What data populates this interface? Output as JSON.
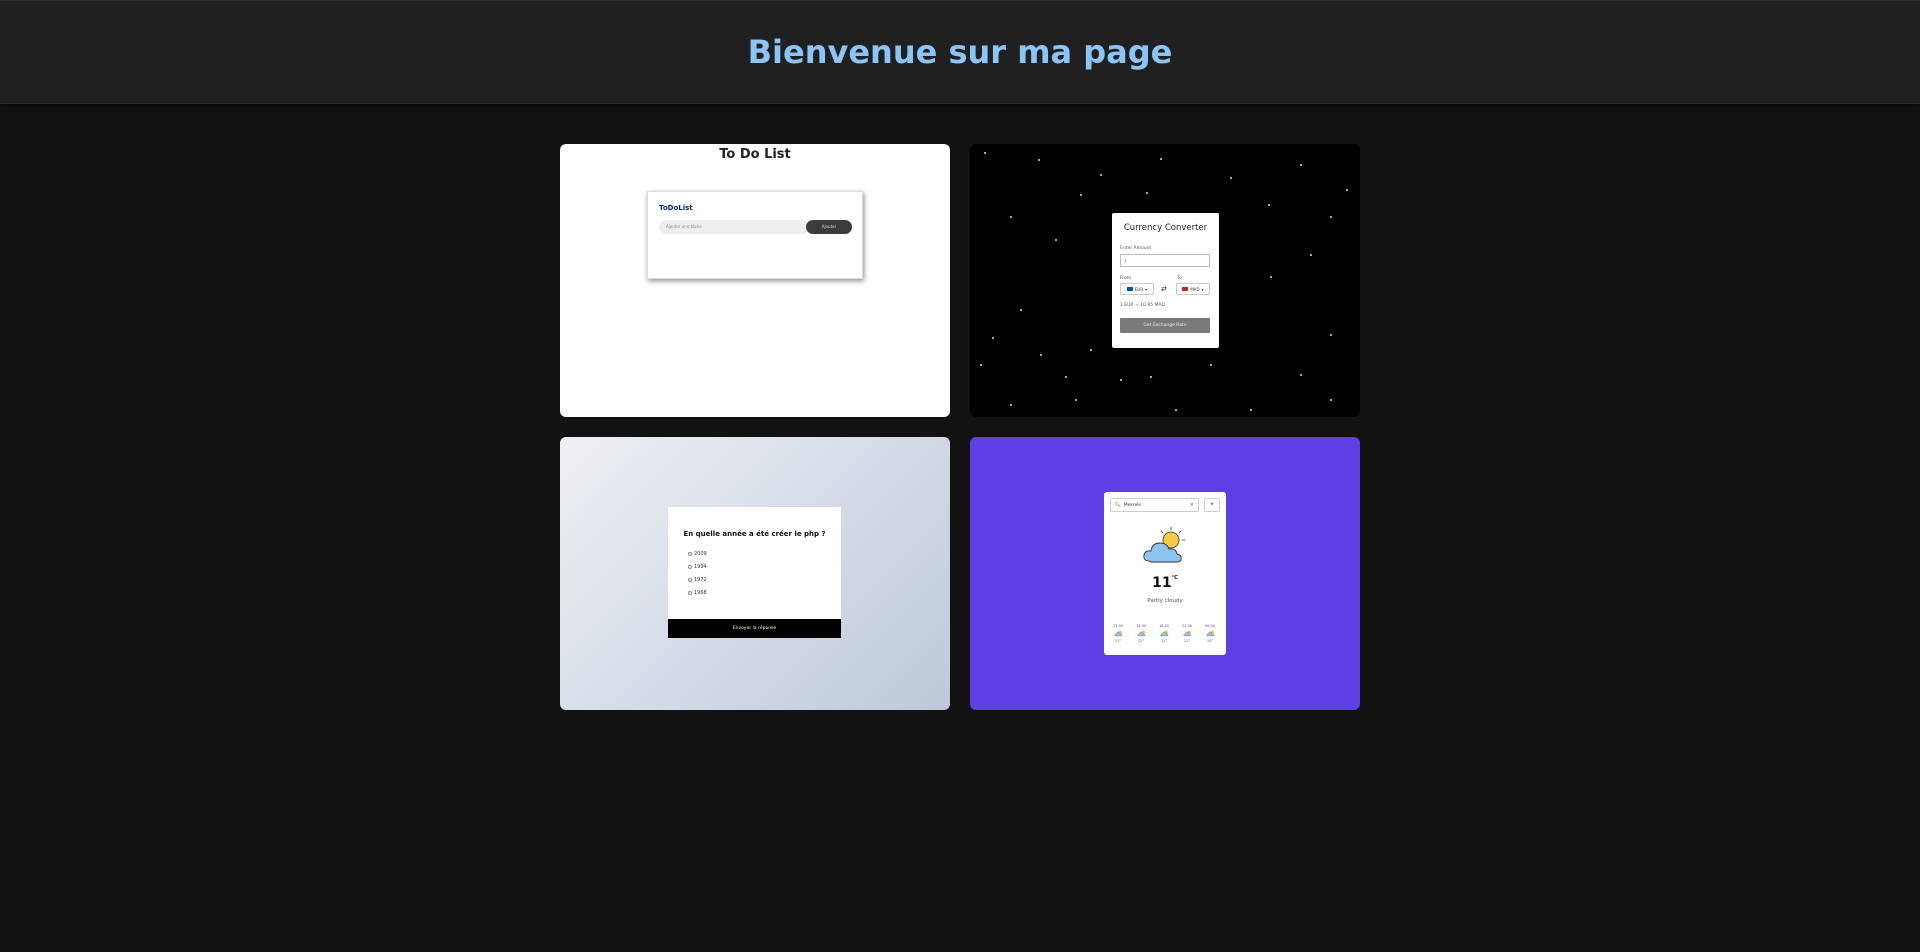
{
  "header": {
    "title": "Bienvenue sur ma page"
  },
  "todo": {
    "page_title": "To Do List",
    "box_title": "ToDoList",
    "input_placeholder": "Ajouter une tâche",
    "add_label": "Ajouter"
  },
  "currency": {
    "title": "Currency Converter",
    "amount_label": "Enter Amount",
    "amount_value": "1",
    "from_label": "From",
    "to_label": "To",
    "from_currency": "EUR",
    "to_currency": "MAD",
    "rate_text": "1 EUR = 10.95 MAD",
    "button_label": "Get Exchange Rate",
    "from_flag_color": "#0055a4",
    "to_flag_color": "#c1272d"
  },
  "quiz": {
    "question": "En quelle année a été créer le php ?",
    "options": [
      "2009",
      "1994",
      "1972",
      "1968"
    ],
    "submit_label": "Envoyer la réponse"
  },
  "weather": {
    "search_value": "Meknès",
    "temperature": "11",
    "unit": "°C",
    "description": "Partly cloudy",
    "forecast": [
      {
        "time": "12:00",
        "temp": "11°"
      },
      {
        "time": "15:00",
        "temp": "12°"
      },
      {
        "time": "18:00",
        "temp": "12°"
      },
      {
        "time": "21:00",
        "temp": "11°"
      },
      {
        "time": "00:00",
        "temp": "10°"
      }
    ]
  },
  "colors": {
    "accent_title": "#8cc4f5",
    "weather_bg": "#5e3fe4",
    "page_bg": "#121212",
    "header_bg": "#202020"
  }
}
